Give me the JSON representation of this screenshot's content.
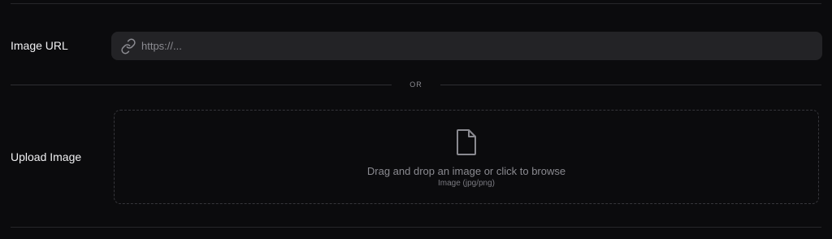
{
  "image_url": {
    "label": "Image URL",
    "placeholder": "https://...",
    "icon": "link-icon"
  },
  "separator": {
    "text": "OR"
  },
  "upload": {
    "label": "Upload Image",
    "title": "Drag and drop an image or click to browse",
    "subtitle": "Image (jpg/png)",
    "icon": "file-icon"
  },
  "colors": {
    "background": "#0b0b0d",
    "input_bg": "#232326",
    "muted_text": "#8a8a90",
    "divider": "#26262a"
  }
}
